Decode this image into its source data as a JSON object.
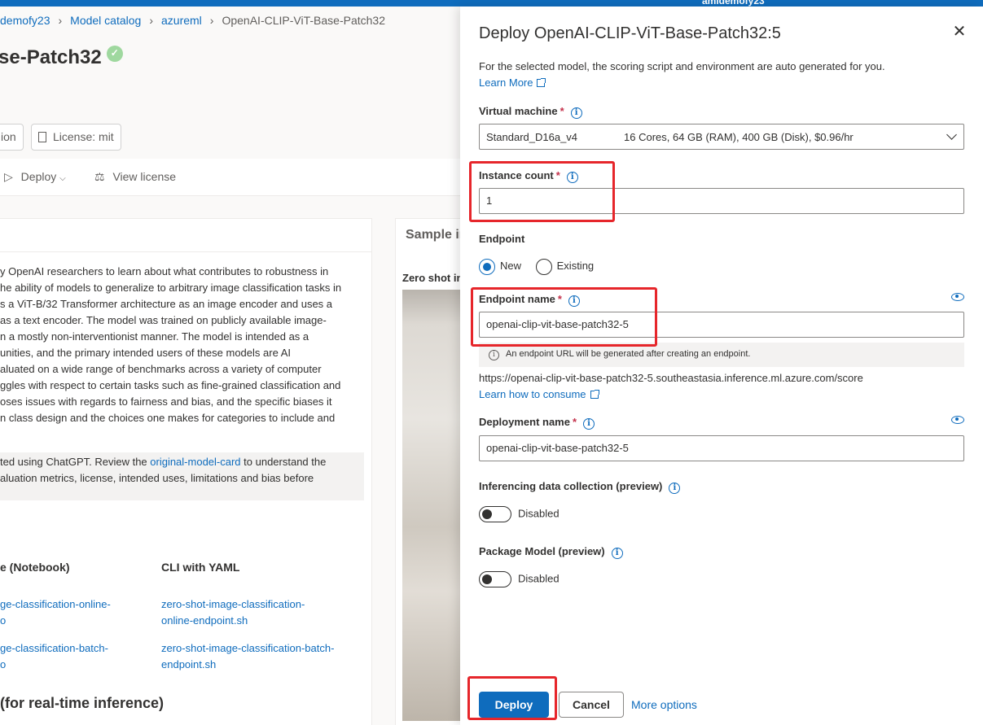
{
  "topbar": {
    "user": "amldemofy23"
  },
  "background": {
    "breadcrumb": [
      "demofy23",
      "Model catalog",
      "azureml",
      "OpenAI-CLIP-ViT-Base-Patch32"
    ],
    "title": "se-Patch32",
    "chips": [
      "ion",
      "License: mit"
    ],
    "toolbar": {
      "deploy": "Deploy",
      "view_license": "View license"
    },
    "description_lines": [
      "y OpenAI researchers to learn about what contributes to robustness in",
      "he ability of models to generalize to arbitrary image classification tasks in",
      "s a ViT-B/32 Transformer architecture as an image encoder and uses a",
      "as a text encoder. The model was trained on publicly available image-",
      "n a mostly non-interventionist manner. The model is intended as a",
      "unities, and the primary intended users of these models are AI",
      "aluated on a wide range of benchmarks across a variety of computer",
      "ggles with respect to certain tasks such as fine-grained classification and",
      "oses issues with regards to fairness and bias, and the specific biases it",
      "n class design and the choices one makes for categories to include and"
    ],
    "note": {
      "prefix": "ted using ChatGPT. Review the ",
      "link": "original-model-card",
      "suffix": " to understand the",
      "line2": "aluation metrics, license, intended uses, limitations and bias before"
    },
    "columns": {
      "notebook": "e (Notebook)",
      "cli": "CLI with YAML"
    },
    "notebook_links": [
      "ge-classification-online-",
      "o",
      "ge-classification-batch-",
      "o"
    ],
    "cli_links": [
      "zero-shot-image-classification-",
      "online-endpoint.sh",
      "zero-shot-image-classification-batch-",
      "endpoint.sh"
    ],
    "bottom_heading": "(for real-time inference)",
    "sample_tab": "Sample in",
    "zero_shot": "Zero shot in"
  },
  "panel": {
    "title": "Deploy OpenAI-CLIP-ViT-Base-Patch32:5",
    "intro": "For the selected model, the scoring script and environment are auto generated for you.",
    "learn_more": "Learn More",
    "vm": {
      "label": "Virtual machine",
      "name": "Standard_D16a_v4",
      "spec": "16 Cores, 64 GB (RAM), 400 GB (Disk), $0.96/hr"
    },
    "instance_count": {
      "label": "Instance count",
      "value": "1"
    },
    "endpoint": {
      "label": "Endpoint",
      "new": "New",
      "existing": "Existing",
      "selected": "New"
    },
    "endpoint_name": {
      "label": "Endpoint name",
      "value": "openai-clip-vit-base-patch32-5"
    },
    "info_message": "An endpoint URL will be generated after creating an endpoint.",
    "score_url": "https://openai-clip-vit-base-patch32-5.southeastasia.inference.ml.azure.com/score",
    "learn_consume": "Learn how to consume",
    "deployment_name": {
      "label": "Deployment name",
      "value": "openai-clip-vit-base-patch32-5"
    },
    "data_collection": {
      "label": "Inferencing data collection (preview)",
      "state": "Disabled"
    },
    "package_model": {
      "label": "Package Model (preview)",
      "state": "Disabled"
    },
    "buttons": {
      "deploy": "Deploy",
      "cancel": "Cancel",
      "more": "More options"
    },
    "required_mark": "*"
  },
  "colors": {
    "accent": "#0f6cbd",
    "highlight": "#e6262b",
    "required": "#c4314b"
  }
}
